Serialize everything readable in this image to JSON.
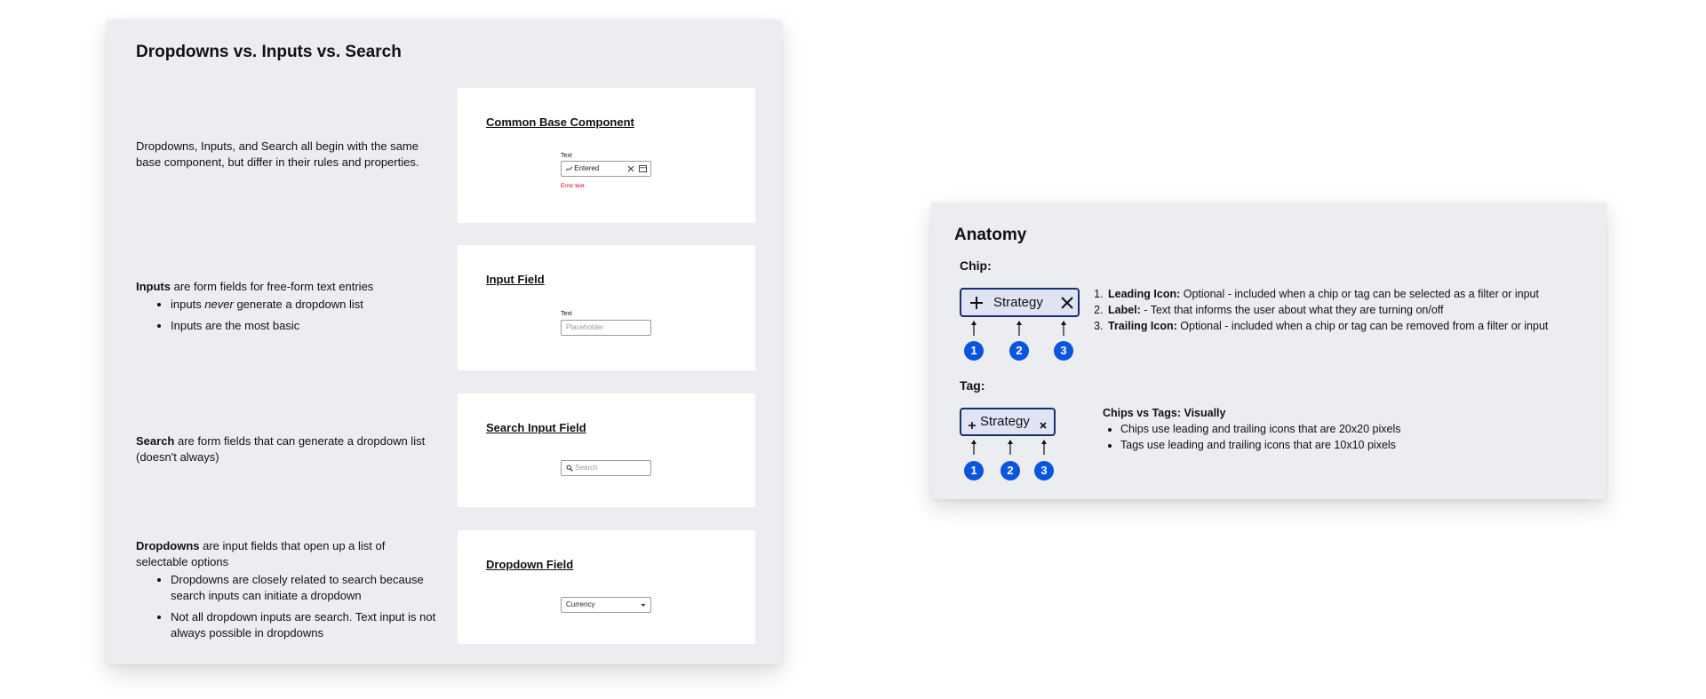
{
  "left_panel": {
    "title": "Dropdowns vs. Inputs vs. Search",
    "sections": [
      {
        "desc_text": "Dropdowns, Inputs, and Search all begin with the same base component, but differ in their rules and properties.",
        "preview_title": "Common Base Component",
        "field_label": "Text",
        "field_value": "Entered",
        "error_text": "Error text"
      },
      {
        "desc_bold": "Inputs",
        "desc_rest": " are form fields for free-form text entries",
        "bullet1_pre": "inputs ",
        "bullet1_em": "never",
        "bullet1_post": " generate a dropdown list",
        "bullet2": "Inputs are the most basic",
        "preview_title": "Input Field",
        "field_label": "Text",
        "field_placeholder": "Placeholder"
      },
      {
        "desc_bold": "Search",
        "desc_rest": " are form fields that can generate a dropdown list (doesn't always)",
        "preview_title": "Search Input Field",
        "field_placeholder": "Search"
      },
      {
        "desc_bold": "Dropdowns",
        "desc_rest": " are input fields that open up a list of selectable options",
        "bullet1": "Dropdowns are closely related to search because search inputs can initiate a dropdown",
        "bullet2": "Not all dropdown inputs are search. Text input is not always possible in dropdowns",
        "preview_title": "Dropdown Field",
        "field_value": "Currency"
      }
    ]
  },
  "right_panel": {
    "title": "Anatomy",
    "chip_label": "Chip:",
    "chip_text": "Strategy",
    "numbers": [
      "1",
      "2",
      "3"
    ],
    "legend": [
      {
        "bold": "Leading Icon:",
        "text": " Optional - included when a chip or tag can be selected as a filter or input"
      },
      {
        "bold": "Label:",
        "text": " - Text that informs the user about what they are turning on/off"
      },
      {
        "bold": "Trailing Icon:",
        "text": " Optional - included when a chip or tag can be removed from a filter or input"
      }
    ],
    "tag_label": "Tag:",
    "tag_text": "Strategy",
    "visual_title": "Chips vs Tags: Visually",
    "visual_bullets": [
      "Chips use leading and trailing icons that are 20x20 pixels",
      "Tags use leading and trailing icons that are 10x10 pixels"
    ]
  },
  "colors": {
    "card_bg": "#ecedf1",
    "chip_fill": "#dfe3f3",
    "chip_border": "#1a2f6e",
    "number_badge": "#0a55e0",
    "error": "#d0021b"
  }
}
